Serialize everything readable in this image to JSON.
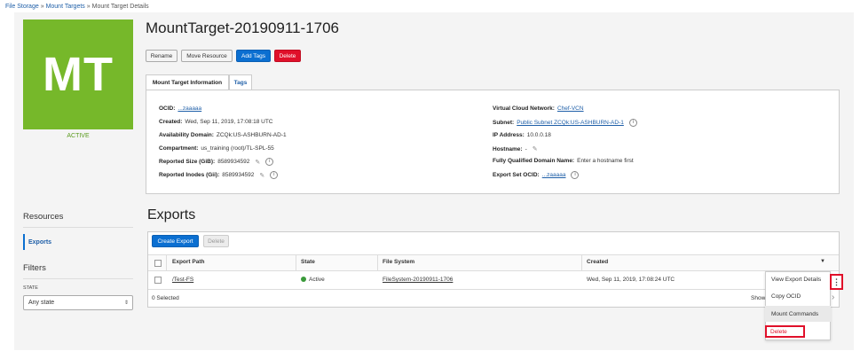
{
  "breadcrumb": {
    "items": [
      "File Storage",
      "Mount Targets",
      "Mount Target Details"
    ],
    "separator": "»"
  },
  "logo": {
    "initials": "MT",
    "status": "ACTIVE",
    "color": "#76b82a"
  },
  "header": {
    "title": "MountTarget-20190911-1706"
  },
  "actions": {
    "rename": "Rename",
    "move": "Move Resource",
    "add_tags": "Add Tags",
    "delete": "Delete"
  },
  "tabs": {
    "info": "Mount Target Information",
    "tags": "Tags"
  },
  "info": {
    "ocid_label": "OCID:",
    "ocid_value": "...zaaaaa",
    "created_label": "Created:",
    "created_value": "Wed, Sep 11, 2019, 17:08:18 UTC",
    "ad_label": "Availability Domain:",
    "ad_value": "ZCQk:US-ASHBURN-AD-1",
    "compartment_label": "Compartment:",
    "compartment_value": "us_training (root)/TL-SPL-55",
    "reported_size_label": "Reported Size (GiB):",
    "reported_size_value": "8589934592",
    "reported_inodes_label": "Reported Inodes (Gii):",
    "reported_inodes_value": "8589934592",
    "vcn_label": "Virtual Cloud Network:",
    "vcn_value": "Chef-VCN",
    "subnet_label": "Subnet:",
    "subnet_value": "Public Subnet ZCQk:US-ASHBURN-AD-1",
    "ip_label": "IP Address:",
    "ip_value": "10.0.0.18",
    "hostname_label": "Hostname:",
    "hostname_value": "-",
    "fqdn_label": "Fully Qualified Domain Name:",
    "fqdn_value": "Enter a hostname first",
    "export_set_label": "Export Set OCID:",
    "export_set_value": "...zaaaaa"
  },
  "resources": {
    "title": "Resources",
    "item": "Exports"
  },
  "filters": {
    "title": "Filters",
    "state_label": "STATE",
    "state_value": "Any state"
  },
  "exports": {
    "title": "Exports",
    "create_button": "Create Export",
    "delete_button": "Delete",
    "columns": [
      "Export Path",
      "State",
      "File System",
      "Created"
    ],
    "rows": [
      {
        "path": "/Test-FS",
        "state": "Active",
        "file_system": "FileSystem-20190911-1706",
        "created": "Wed, Sep 11, 2019, 17:08:24 UTC"
      }
    ],
    "selected": "0 Selected",
    "show": "Show"
  },
  "row_menu": {
    "items": [
      "View Export Details",
      "Copy OCID",
      "Mount Commands",
      "Delete"
    ]
  }
}
